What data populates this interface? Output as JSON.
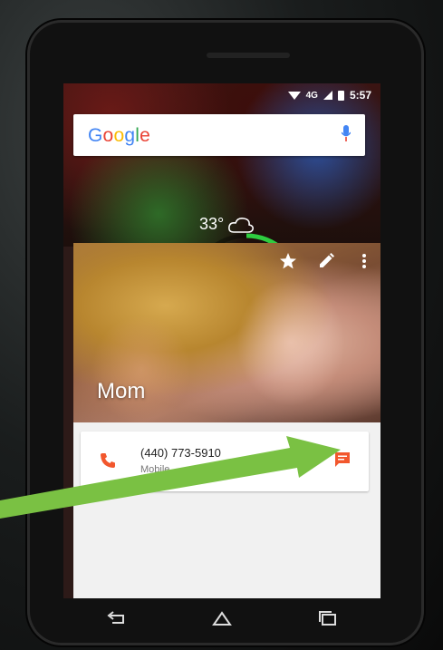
{
  "status_bar": {
    "network": "4G",
    "time": "5:57"
  },
  "search": {
    "logo": "Google",
    "icon": "mic-icon"
  },
  "weather": {
    "temperature": "33°",
    "icon": "cloud-icon"
  },
  "contact": {
    "name": "Mom",
    "actions": [
      "star-icon",
      "edit-icon",
      "more-vert-icon"
    ],
    "phone": {
      "number": "(440) 773-5910",
      "type": "Mobile"
    }
  },
  "nav_bar": [
    "back-icon",
    "home-icon",
    "recents-icon"
  ],
  "colors": {
    "accent": "#f2572d",
    "arrow": "#7ac143",
    "google_blue": "#4285f4",
    "google_red": "#ea4335",
    "google_yellow": "#fbbc05",
    "google_green": "#34a853"
  }
}
